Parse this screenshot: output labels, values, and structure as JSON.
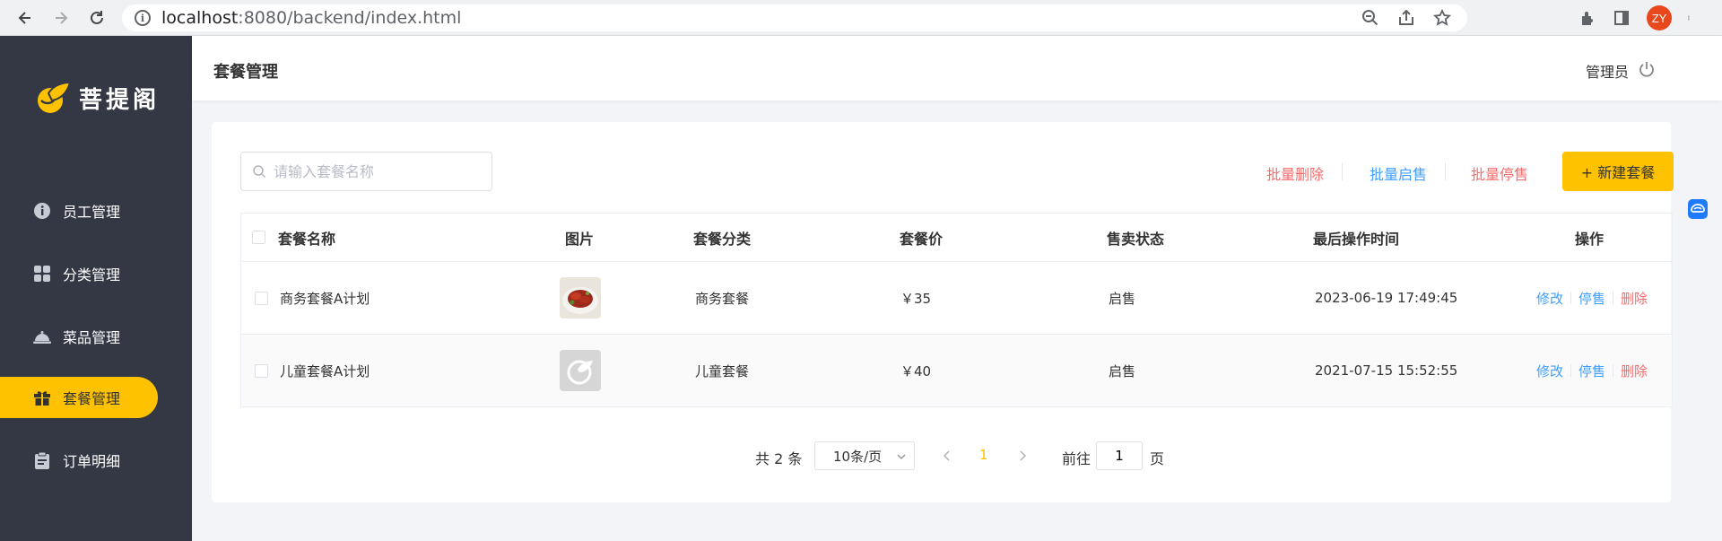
{
  "browser": {
    "url_host": "localhost",
    "url_rest": ":8080/backend/index.html",
    "avatar": "ZY"
  },
  "sidebar": {
    "logo_text": "菩提阁",
    "items": [
      {
        "label": "员工管理",
        "icon": "info-circle-icon"
      },
      {
        "label": "分类管理",
        "icon": "grid-icon"
      },
      {
        "label": "菜品管理",
        "icon": "dish-icon"
      },
      {
        "label": "套餐管理",
        "icon": "gift-icon",
        "active": true
      },
      {
        "label": "订单明细",
        "icon": "clipboard-icon"
      }
    ]
  },
  "header": {
    "title": "套餐管理",
    "user": "管理员"
  },
  "toolbar": {
    "search_placeholder": "请输入套餐名称",
    "batch_delete": "批量删除",
    "batch_enable": "批量启售",
    "batch_disable": "批量停售",
    "new_button": "+ 新建套餐"
  },
  "table": {
    "columns": [
      "套餐名称",
      "图片",
      "套餐分类",
      "套餐价",
      "售卖状态",
      "最后操作时间",
      "操作"
    ],
    "rows": [
      {
        "name": "商务套餐A计划",
        "category": "商务套餐",
        "price": "￥35",
        "status": "启售",
        "time": "2023-06-19 17:49:45",
        "edit": "修改",
        "stop": "停售",
        "del": "删除"
      },
      {
        "name": "儿童套餐A计划",
        "category": "儿童套餐",
        "price": "￥40",
        "status": "启售",
        "time": "2021-07-15 15:52:55",
        "edit": "修改",
        "stop": "停售",
        "del": "删除"
      }
    ]
  },
  "pagination": {
    "total": "共 2 条",
    "page_size": "10条/页",
    "current": "1",
    "goto_label": "前往",
    "goto_value": "1",
    "goto_suffix": "页"
  },
  "colors": {
    "accent": "#ffc200",
    "sidebar": "#343744",
    "link_blue": "#409eff",
    "danger": "#f56c6c"
  }
}
